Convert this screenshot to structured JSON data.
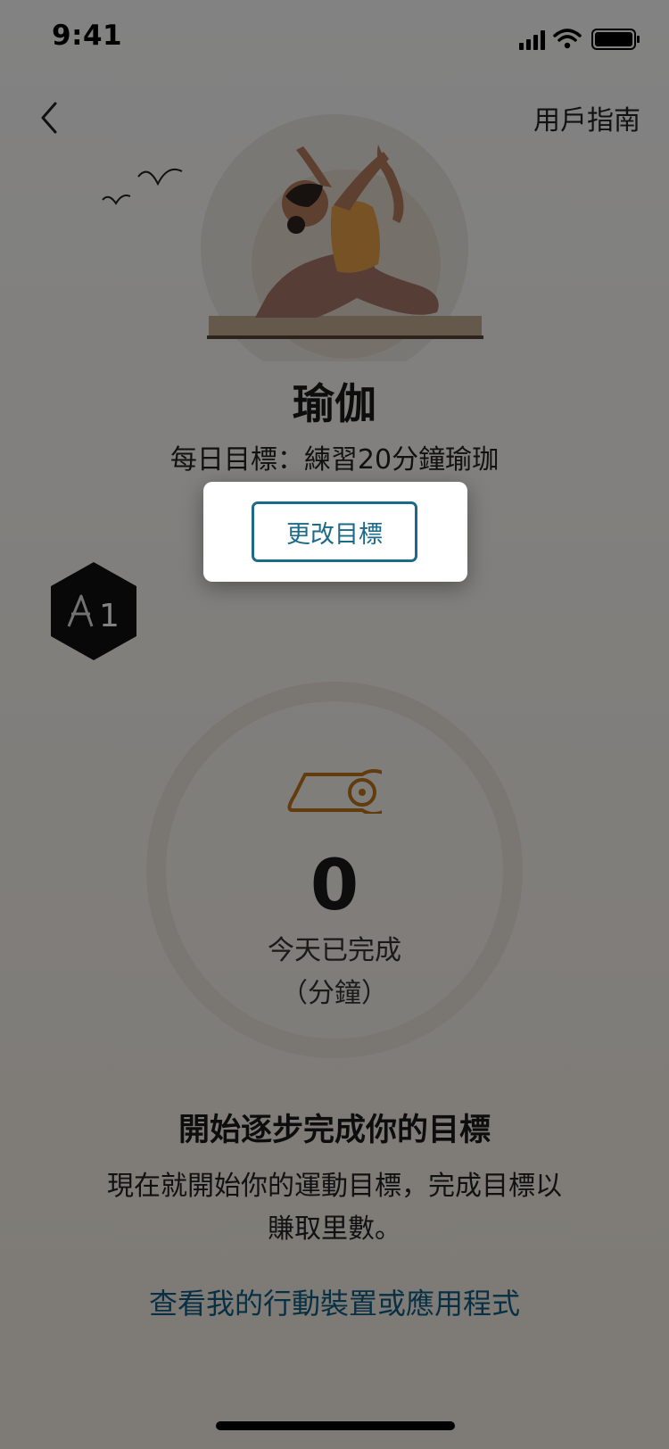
{
  "status_bar": {
    "time": "9:41"
  },
  "header": {
    "back_icon": "chevron-left-icon",
    "guide_label": "用戶指南"
  },
  "activity": {
    "title": "瑜伽",
    "daily_goal": "每日目標：練習20分鐘瑜珈"
  },
  "popup": {
    "change_goal_label": "更改目標"
  },
  "badge": {
    "label": "1"
  },
  "progress": {
    "minutes_value": "0",
    "completed_label": "今天已完成",
    "unit_label": "（分鐘）",
    "ring_fraction": 0
  },
  "cta": {
    "title": "開始逐步完成你的目標",
    "description_line1": "現在就開始你的運動目標，完成目標以",
    "description_line2": "賺取里數。",
    "device_link": "查看我的行動裝置或應用程式"
  },
  "colors": {
    "accent_link": "#0f5e85",
    "button_border": "#1b6a8a",
    "mat_icon": "#c0761d",
    "overlay": "rgba(0,0,0,0.49)"
  }
}
